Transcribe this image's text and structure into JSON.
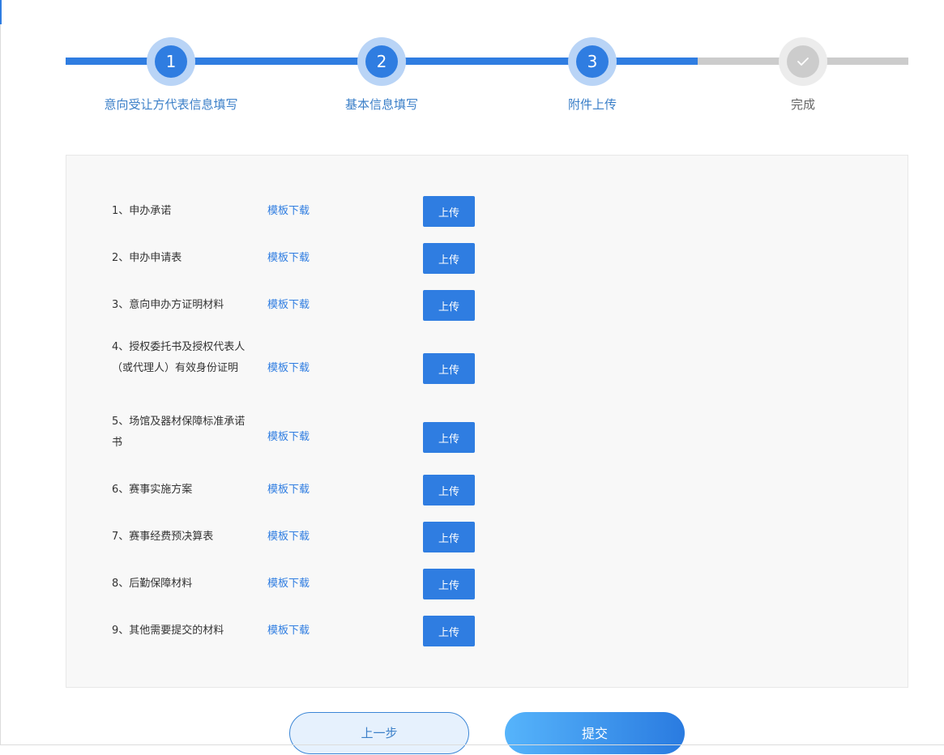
{
  "steps": [
    {
      "number": "1",
      "label": "意向受让方代表信息填写",
      "state": "done"
    },
    {
      "number": "2",
      "label": "基本信息填写",
      "state": "done"
    },
    {
      "number": "3",
      "label": "附件上传",
      "state": "current"
    },
    {
      "icon": "check-icon",
      "label": "完成",
      "state": "pending"
    }
  ],
  "documents": [
    {
      "name": "1、申办承诺",
      "link": "模板下载",
      "button": "上传"
    },
    {
      "name": "2、申办申请表",
      "link": "模板下载",
      "button": "上传"
    },
    {
      "name": "3、意向申办方证明材料",
      "link": "模板下载",
      "button": "上传"
    },
    {
      "name": "4、授权委托书及授权代表人（或代理人）有效身份证明",
      "link": "模板下载",
      "button": "上传"
    },
    {
      "name": "5、场馆及器材保障标准承诺书",
      "link": "模板下载",
      "button": "上传"
    },
    {
      "name": "6、赛事实施方案",
      "link": "模板下载",
      "button": "上传"
    },
    {
      "name": "7、赛事经费预决算表",
      "link": "模板下载",
      "button": "上传"
    },
    {
      "name": "8、后勤保障材料",
      "link": "模板下载",
      "button": "上传"
    },
    {
      "name": "9、其他需要提交的材料",
      "link": "模板下载",
      "button": "上传"
    }
  ],
  "actions": {
    "prev": "上一步",
    "submit": "提交"
  },
  "colors": {
    "primary": "#2f7de1",
    "pending": "#cccccc",
    "panel": "#f8f8f8"
  }
}
